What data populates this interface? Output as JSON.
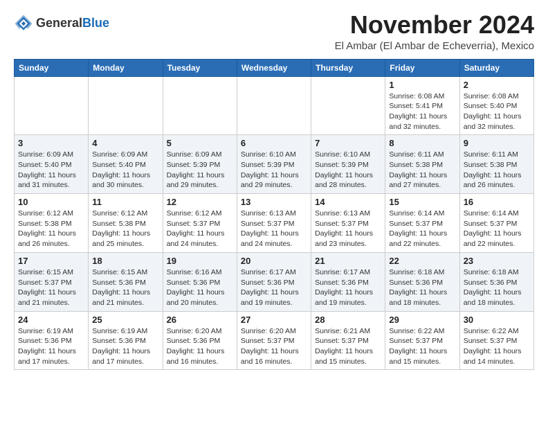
{
  "header": {
    "logo_general": "General",
    "logo_blue": "Blue",
    "month_title": "November 2024",
    "subtitle": "El Ambar (El Ambar de Echeverria), Mexico"
  },
  "weekdays": [
    "Sunday",
    "Monday",
    "Tuesday",
    "Wednesday",
    "Thursday",
    "Friday",
    "Saturday"
  ],
  "weeks": [
    [
      {
        "day": "",
        "info": ""
      },
      {
        "day": "",
        "info": ""
      },
      {
        "day": "",
        "info": ""
      },
      {
        "day": "",
        "info": ""
      },
      {
        "day": "",
        "info": ""
      },
      {
        "day": "1",
        "info": "Sunrise: 6:08 AM\nSunset: 5:41 PM\nDaylight: 11 hours and 32 minutes."
      },
      {
        "day": "2",
        "info": "Sunrise: 6:08 AM\nSunset: 5:40 PM\nDaylight: 11 hours and 32 minutes."
      }
    ],
    [
      {
        "day": "3",
        "info": "Sunrise: 6:09 AM\nSunset: 5:40 PM\nDaylight: 11 hours and 31 minutes."
      },
      {
        "day": "4",
        "info": "Sunrise: 6:09 AM\nSunset: 5:40 PM\nDaylight: 11 hours and 30 minutes."
      },
      {
        "day": "5",
        "info": "Sunrise: 6:09 AM\nSunset: 5:39 PM\nDaylight: 11 hours and 29 minutes."
      },
      {
        "day": "6",
        "info": "Sunrise: 6:10 AM\nSunset: 5:39 PM\nDaylight: 11 hours and 29 minutes."
      },
      {
        "day": "7",
        "info": "Sunrise: 6:10 AM\nSunset: 5:39 PM\nDaylight: 11 hours and 28 minutes."
      },
      {
        "day": "8",
        "info": "Sunrise: 6:11 AM\nSunset: 5:38 PM\nDaylight: 11 hours and 27 minutes."
      },
      {
        "day": "9",
        "info": "Sunrise: 6:11 AM\nSunset: 5:38 PM\nDaylight: 11 hours and 26 minutes."
      }
    ],
    [
      {
        "day": "10",
        "info": "Sunrise: 6:12 AM\nSunset: 5:38 PM\nDaylight: 11 hours and 26 minutes."
      },
      {
        "day": "11",
        "info": "Sunrise: 6:12 AM\nSunset: 5:38 PM\nDaylight: 11 hours and 25 minutes."
      },
      {
        "day": "12",
        "info": "Sunrise: 6:12 AM\nSunset: 5:37 PM\nDaylight: 11 hours and 24 minutes."
      },
      {
        "day": "13",
        "info": "Sunrise: 6:13 AM\nSunset: 5:37 PM\nDaylight: 11 hours and 24 minutes."
      },
      {
        "day": "14",
        "info": "Sunrise: 6:13 AM\nSunset: 5:37 PM\nDaylight: 11 hours and 23 minutes."
      },
      {
        "day": "15",
        "info": "Sunrise: 6:14 AM\nSunset: 5:37 PM\nDaylight: 11 hours and 22 minutes."
      },
      {
        "day": "16",
        "info": "Sunrise: 6:14 AM\nSunset: 5:37 PM\nDaylight: 11 hours and 22 minutes."
      }
    ],
    [
      {
        "day": "17",
        "info": "Sunrise: 6:15 AM\nSunset: 5:37 PM\nDaylight: 11 hours and 21 minutes."
      },
      {
        "day": "18",
        "info": "Sunrise: 6:15 AM\nSunset: 5:36 PM\nDaylight: 11 hours and 21 minutes."
      },
      {
        "day": "19",
        "info": "Sunrise: 6:16 AM\nSunset: 5:36 PM\nDaylight: 11 hours and 20 minutes."
      },
      {
        "day": "20",
        "info": "Sunrise: 6:17 AM\nSunset: 5:36 PM\nDaylight: 11 hours and 19 minutes."
      },
      {
        "day": "21",
        "info": "Sunrise: 6:17 AM\nSunset: 5:36 PM\nDaylight: 11 hours and 19 minutes."
      },
      {
        "day": "22",
        "info": "Sunrise: 6:18 AM\nSunset: 5:36 PM\nDaylight: 11 hours and 18 minutes."
      },
      {
        "day": "23",
        "info": "Sunrise: 6:18 AM\nSunset: 5:36 PM\nDaylight: 11 hours and 18 minutes."
      }
    ],
    [
      {
        "day": "24",
        "info": "Sunrise: 6:19 AM\nSunset: 5:36 PM\nDaylight: 11 hours and 17 minutes."
      },
      {
        "day": "25",
        "info": "Sunrise: 6:19 AM\nSunset: 5:36 PM\nDaylight: 11 hours and 17 minutes."
      },
      {
        "day": "26",
        "info": "Sunrise: 6:20 AM\nSunset: 5:36 PM\nDaylight: 11 hours and 16 minutes."
      },
      {
        "day": "27",
        "info": "Sunrise: 6:20 AM\nSunset: 5:37 PM\nDaylight: 11 hours and 16 minutes."
      },
      {
        "day": "28",
        "info": "Sunrise: 6:21 AM\nSunset: 5:37 PM\nDaylight: 11 hours and 15 minutes."
      },
      {
        "day": "29",
        "info": "Sunrise: 6:22 AM\nSunset: 5:37 PM\nDaylight: 11 hours and 15 minutes."
      },
      {
        "day": "30",
        "info": "Sunrise: 6:22 AM\nSunset: 5:37 PM\nDaylight: 11 hours and 14 minutes."
      }
    ]
  ]
}
